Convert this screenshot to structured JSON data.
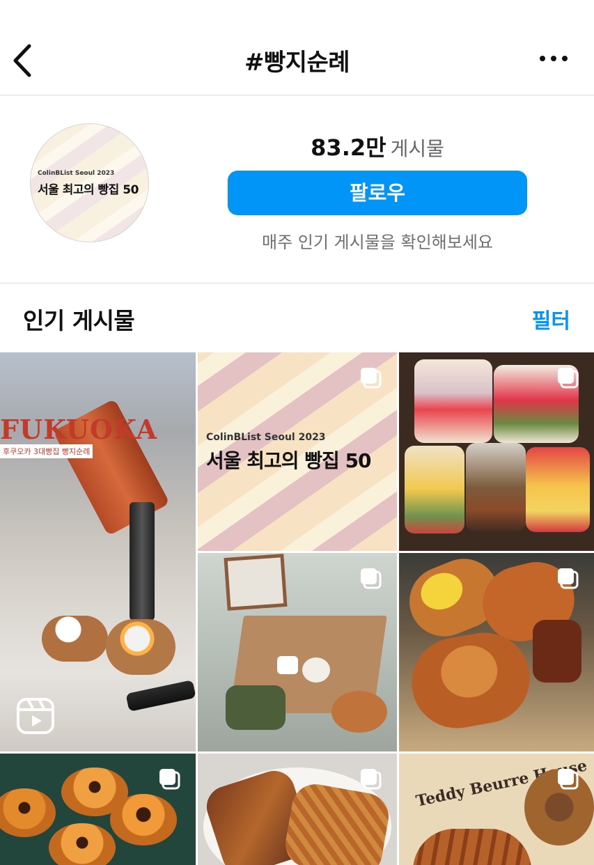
{
  "header": {
    "back_icon": "chevron-left-icon",
    "title": "#빵지순례",
    "more_icon": "more-horizontal-icon"
  },
  "profile": {
    "avatar_sub": "ColinBList Seoul 2023",
    "avatar_main": "서울 최고의 빵집 50",
    "post_count": "83.2만",
    "post_count_label": "게시물",
    "follow_label": "팔로우",
    "subtitle": "매주 인기 게시물을 확인해보세요"
  },
  "section": {
    "title": "인기 게시물",
    "filter_label": "필터"
  },
  "grid": {
    "posts": [
      {
        "type": "reel",
        "overlay_title": "FUKUOKA",
        "overlay_sub": "후쿠오카 3대빵집 빵지순례"
      },
      {
        "type": "carousel",
        "overlay_sub": "ColinBList Seoul 2023",
        "overlay_title": "서울 최고의 빵집 50"
      },
      {
        "type": "carousel"
      },
      {
        "type": "carousel"
      },
      {
        "type": "carousel"
      },
      {
        "type": "carousel"
      },
      {
        "type": "carousel"
      },
      {
        "type": "carousel",
        "overlay_title": "Teddy Beurre House"
      }
    ]
  },
  "colors": {
    "accent": "#0095f6",
    "divider": "#dbdbdb",
    "secondary_text": "#6e6e6e"
  }
}
